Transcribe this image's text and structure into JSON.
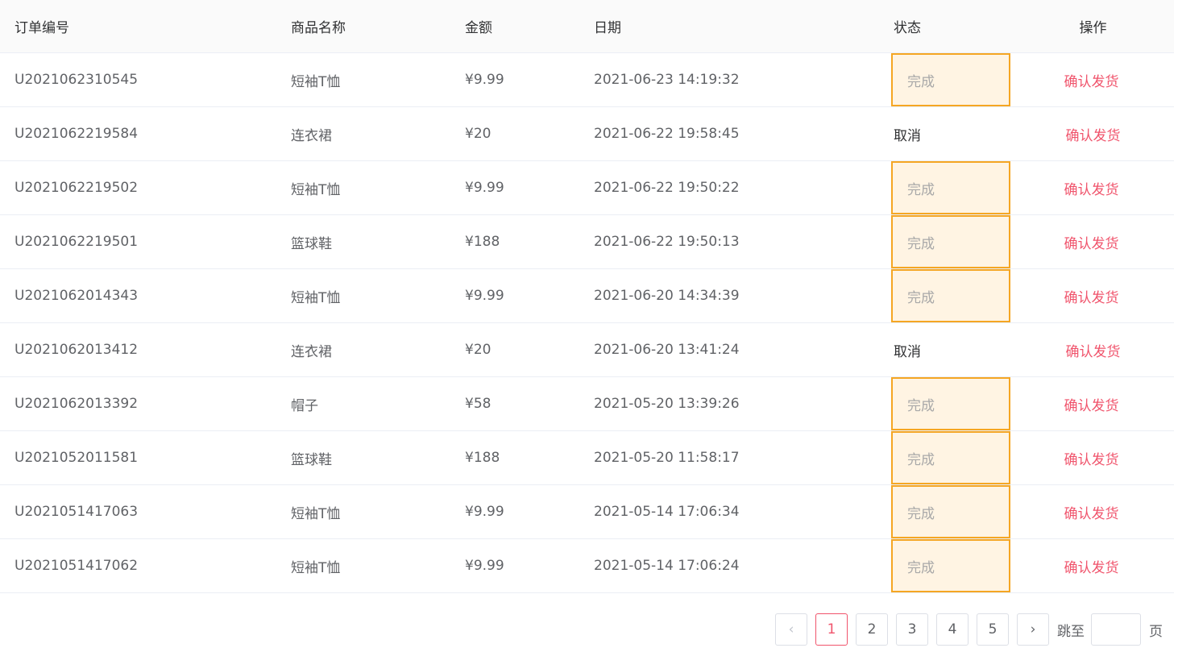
{
  "table": {
    "headers": {
      "order_id": "订单编号",
      "product": "商品名称",
      "amount": "金额",
      "date": "日期",
      "status": "状态",
      "action": "操作"
    },
    "rows": [
      {
        "order_id": "U2021062310545",
        "product": "短袖T恤",
        "amount": "¥9.99",
        "date": "2021-06-23 14:19:32",
        "status": "完成",
        "action": "确认发货"
      },
      {
        "order_id": "U2021062219584",
        "product": "连衣裙",
        "amount": "¥20",
        "date": "2021-06-22 19:58:45",
        "status": "取消",
        "action": "确认发货"
      },
      {
        "order_id": "U2021062219502",
        "product": "短袖T恤",
        "amount": "¥9.99",
        "date": "2021-06-22 19:50:22",
        "status": "完成",
        "action": "确认发货"
      },
      {
        "order_id": "U2021062219501",
        "product": "篮球鞋",
        "amount": "¥188",
        "date": "2021-06-22 19:50:13",
        "status": "完成",
        "action": "确认发货"
      },
      {
        "order_id": "U2021062014343",
        "product": "短袖T恤",
        "amount": "¥9.99",
        "date": "2021-06-20 14:34:39",
        "status": "完成",
        "action": "确认发货"
      },
      {
        "order_id": "U2021062013412",
        "product": "连衣裙",
        "amount": "¥20",
        "date": "2021-06-20 13:41:24",
        "status": "取消",
        "action": "确认发货"
      },
      {
        "order_id": "U2021062013392",
        "product": "帽子",
        "amount": "¥58",
        "date": "2021-05-20 13:39:26",
        "status": "完成",
        "action": "确认发货"
      },
      {
        "order_id": "U2021052011581",
        "product": "篮球鞋",
        "amount": "¥188",
        "date": "2021-05-20 11:58:17",
        "status": "完成",
        "action": "确认发货"
      },
      {
        "order_id": "U2021051417063",
        "product": "短袖T恤",
        "amount": "¥9.99",
        "date": "2021-05-14 17:06:34",
        "status": "完成",
        "action": "确认发货"
      },
      {
        "order_id": "U2021051417062",
        "product": "短袖T恤",
        "amount": "¥9.99",
        "date": "2021-05-14 17:06:24",
        "status": "完成",
        "action": "确认发货"
      }
    ]
  },
  "pagination": {
    "prev_icon": "‹",
    "next_icon": "›",
    "pages": [
      "1",
      "2",
      "3",
      "4",
      "5"
    ],
    "current_page": "1",
    "jump_label": "跳至",
    "jump_value": "",
    "page_suffix": "页"
  },
  "colors": {
    "accent": "#f0546c",
    "status_done_border": "#f5a623",
    "status_done_bg": "#fff4e3"
  }
}
